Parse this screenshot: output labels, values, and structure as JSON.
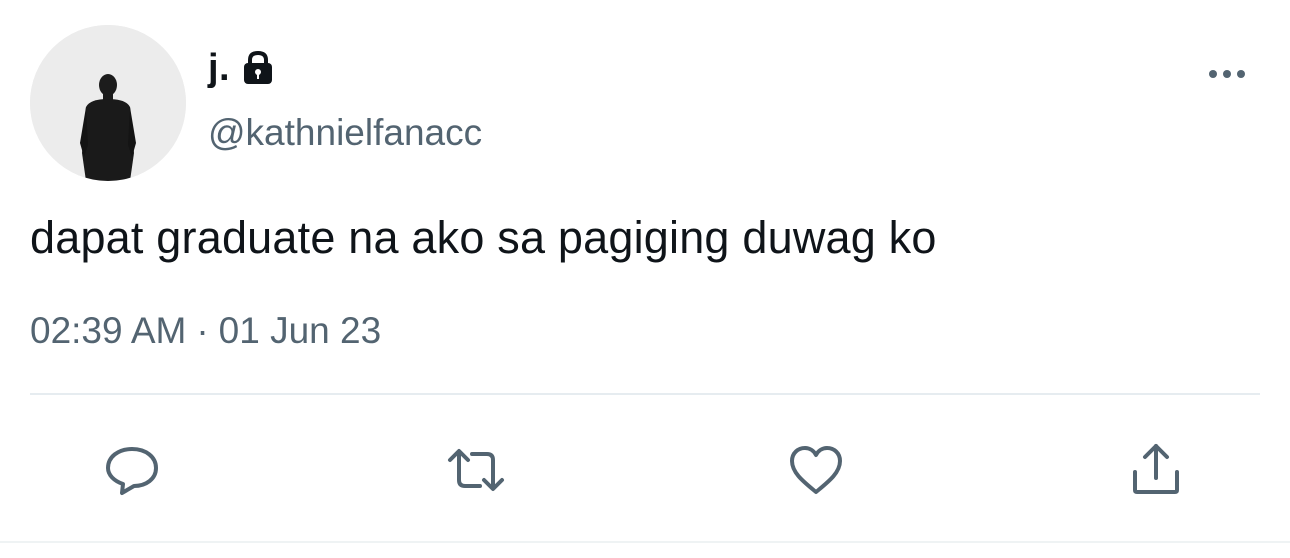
{
  "profile": {
    "display_name": "j.",
    "handle": "@kathnielfanacc",
    "locked_icon": "lock-icon",
    "avatar": "avatar-photo"
  },
  "tweet": {
    "text": "dapat graduate na ako sa pagiging duwag ko",
    "time": "02:39 AM",
    "separator": "·",
    "date": "01 Jun 23"
  },
  "actions": [
    {
      "icon": "reply-icon"
    },
    {
      "icon": "retweet-icon"
    },
    {
      "icon": "like-icon"
    },
    {
      "icon": "share-icon"
    }
  ],
  "menu": {
    "icon": "more-options-icon"
  },
  "colors": {
    "text_primary": "#0f1419",
    "text_secondary": "#536471",
    "divider": "#e6ecf0"
  }
}
